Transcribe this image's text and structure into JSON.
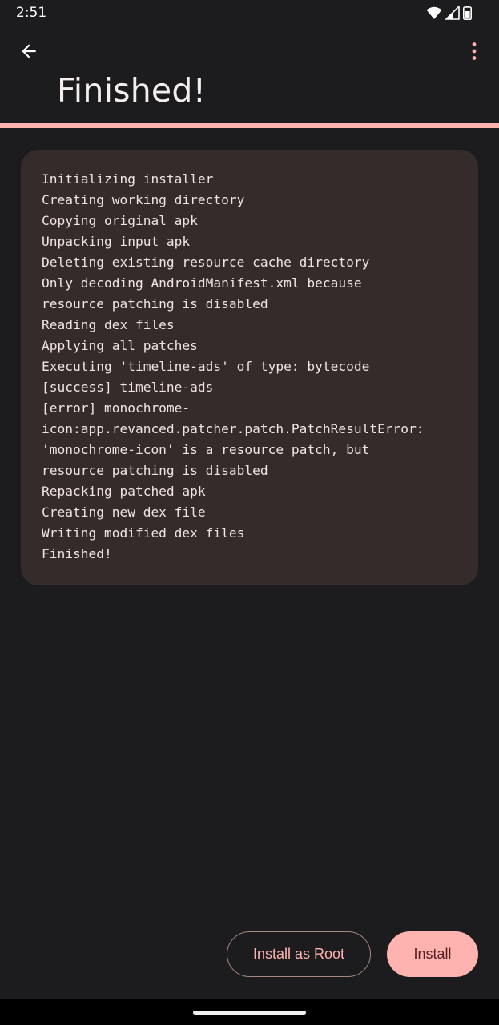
{
  "status_bar": {
    "time": "2:51",
    "icons": [
      "wifi-icon",
      "signal-icon",
      "battery-icon"
    ]
  },
  "app_bar": {
    "back_icon": "arrow-back-icon",
    "more_icon": "more-vert-icon",
    "title": "Finished!"
  },
  "progress": {
    "value_fraction": 1.0,
    "color": "#ffb3b1"
  },
  "log": {
    "lines": [
      "Initializing installer",
      "Creating working directory",
      "Copying original apk",
      "Unpacking input apk",
      "Deleting existing resource cache directory",
      "Only decoding AndroidManifest.xml because",
      "resource patching is disabled",
      "Reading dex files",
      "Applying all patches",
      "Executing 'timeline-ads' of type: bytecode",
      "[success] timeline-ads",
      "[error] monochrome-",
      "icon:app.revanced.patcher.patch.PatchResultError:",
      "'monochrome-icon' is a resource patch, but",
      "resource patching is disabled",
      "Repacking patched apk",
      "Creating new dex file",
      "Writing modified dex files",
      "Finished!"
    ]
  },
  "actions": {
    "install_root_label": "Install as Root",
    "install_label": "Install"
  },
  "colors": {
    "background": "#1c1b1d",
    "card": "#352b2b",
    "accent": "#ffb3b1",
    "on_accent": "#5a1d1f"
  }
}
